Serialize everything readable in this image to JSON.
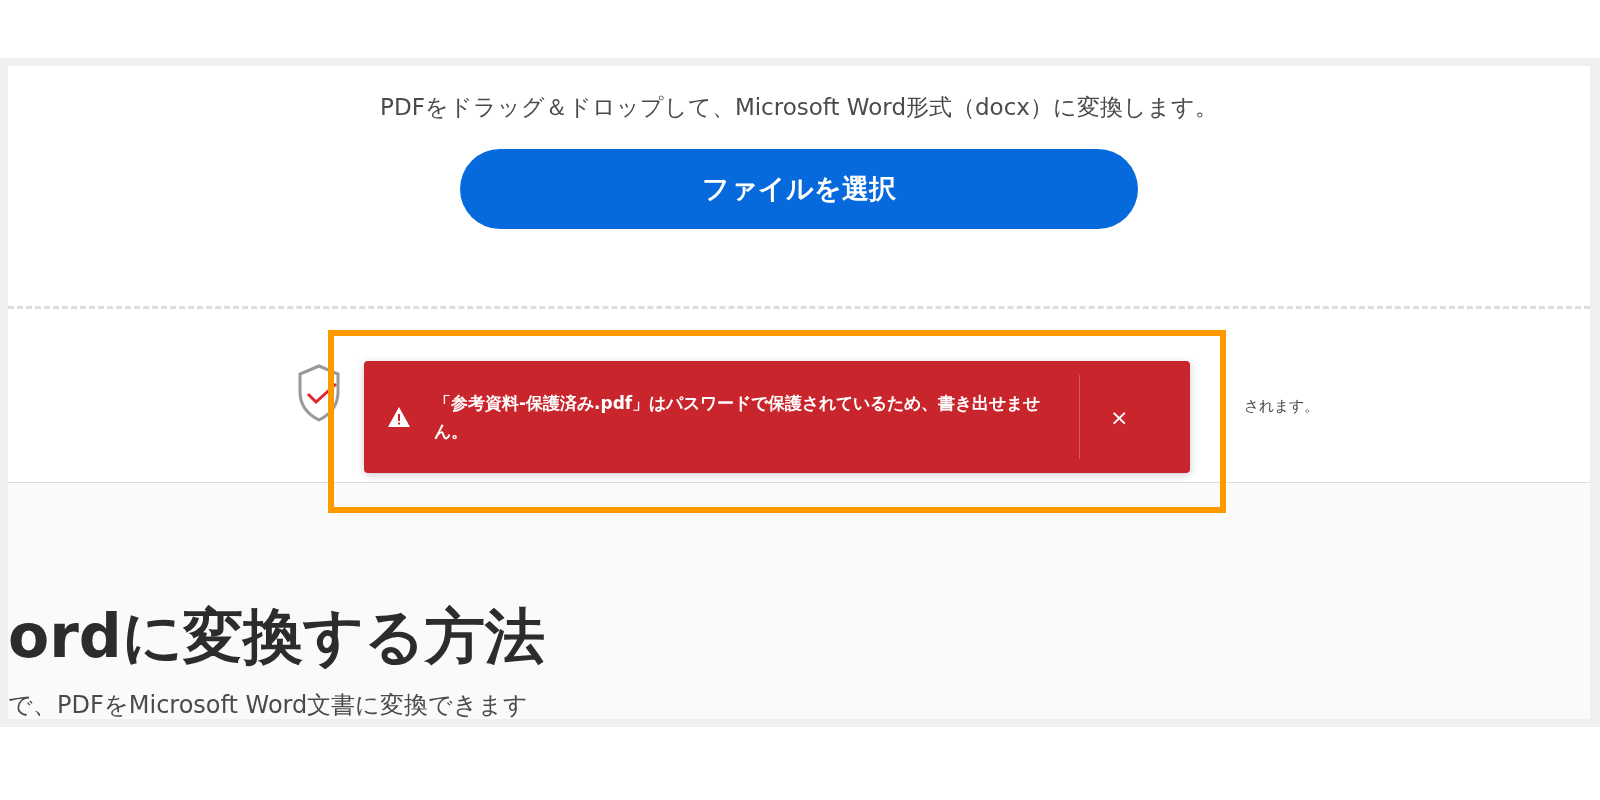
{
  "instruction": "PDFをドラッグ＆ドロップして、Microsoft Word形式（docx）に変換します。",
  "select_button": "ファイルを選択",
  "security_note": "されます。",
  "error_toast": {
    "message": "「参考資料-保護済み.pdf」はパスワードで保護されているため、書き出せません。",
    "close": "×",
    "highlighted": true
  },
  "howto": {
    "heading": "ordに変換する方法",
    "body": "で、PDFをMicrosoft Word文書に変換できます"
  }
}
